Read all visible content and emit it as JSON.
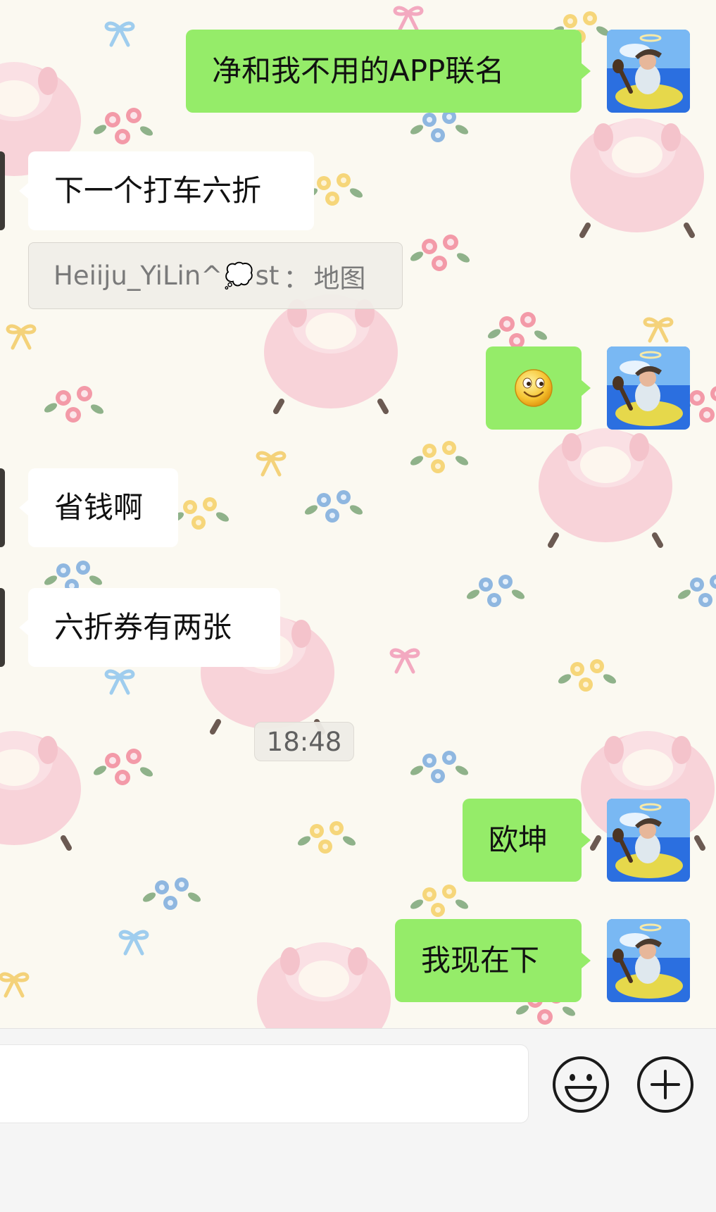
{
  "chat": {
    "messages": [
      {
        "side": "out",
        "text": "净和我不用的APP联名"
      },
      {
        "side": "in",
        "text": "下一个打车六折"
      },
      {
        "side": "out",
        "text": "🙂"
      },
      {
        "side": "in",
        "text": "省钱啊"
      },
      {
        "side": "in",
        "text": "六折券有两张"
      },
      {
        "side": "out",
        "text": "欧坤"
      },
      {
        "side": "out",
        "text": "我现在下"
      }
    ],
    "quote": {
      "name_before": "Heiiju_YiLin^",
      "cloud": "💭",
      "name_after": "st",
      "separator": "：",
      "content": "地图"
    },
    "timestamp": "18:48"
  },
  "input_bar": {
    "placeholder": "",
    "emoji_icon": "smiley-face-icon",
    "more_icon": "plus-circle-icon"
  },
  "colors": {
    "outgoing_bubble": "#95ec69",
    "incoming_bubble": "#ffffff",
    "background": "#fbf9f1",
    "bar": "#f5f5f5"
  }
}
